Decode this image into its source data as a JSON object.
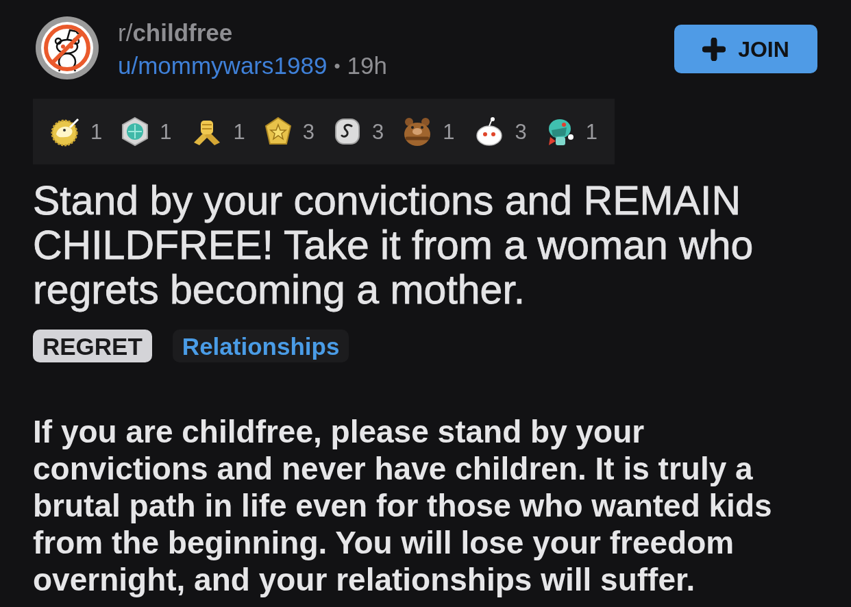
{
  "post_header": {
    "subreddit": "r/**childfree**",
    "author": "u/mommywars1989",
    "separator": "•",
    "time": "19h",
    "join_button": {
      "label": "JOIN"
    }
  },
  "awards": [
    {
      "count": "1"
    },
    {
      "count": "1"
    },
    {
      "count": "1"
    },
    {
      "count": "3"
    },
    {
      "count": "3"
    },
    {
      "count": "1"
    },
    {
      "count": "3"
    },
    {
      "count": "1"
    }
  ],
  "title": "Stand by your convictions and REMAIN CHILDFREE! Take it from a woman who regrets becoming a mother.",
  "flairs": [
    {
      "label": "REGRET",
      "kind": "solid"
    },
    {
      "label": "Relationships",
      "kind": "subtle"
    }
  ],
  "body": "If you are childfree, please stand by your convictions and never have children. It is truly a brutal path in life even for those who wanted kids from the beginning. You will lose your freedom overnight, and your relationships will suffer."
}
